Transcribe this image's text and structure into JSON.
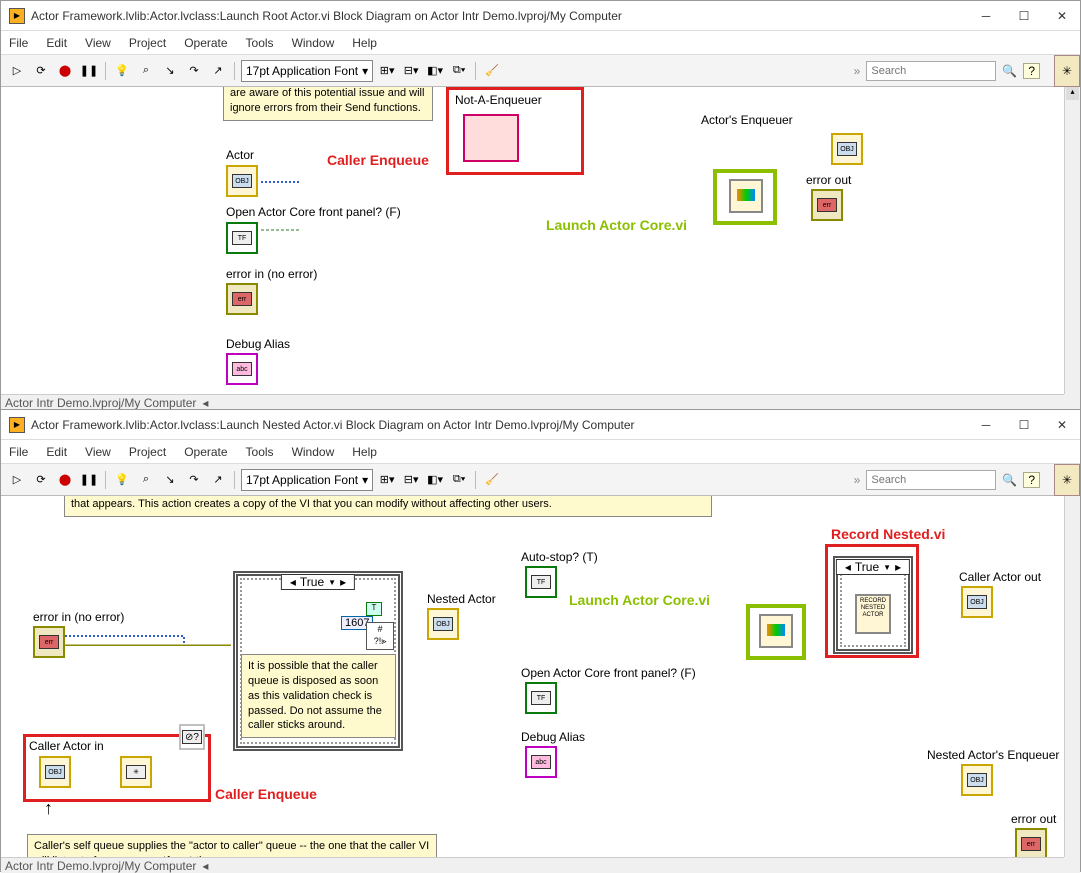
{
  "top": {
    "title": "Actor Framework.lvlib:Actor.lvclass:Launch Root Actor.vi Block Diagram on Actor Intr Demo.lvproj/My Computer",
    "menu": [
      "File",
      "Edit",
      "View",
      "Project",
      "Operate",
      "Tools",
      "Window",
      "Help"
    ],
    "font": "17pt Application Font",
    "search_placeholder": "Search",
    "path": "Actor Intr Demo.lvproj/My Computer",
    "tip": "are aware of this potential issue and will ignore errors from their Send functions.",
    "labels": {
      "actor": "Actor",
      "open_fp": "Open Actor Core front panel? (F)",
      "errin": "error in (no error)",
      "debug": "Debug Alias",
      "nae": "Not-A-Enqueuer",
      "actorenq": "Actor's Enqueuer",
      "errout": "error out"
    },
    "ann": {
      "caller_enq": "Caller Enqueue",
      "launch": "Launch Actor Core.vi"
    }
  },
  "bot": {
    "title": "Actor Framework.lvlib:Actor.lvclass:Launch Nested Actor.vi Block Diagram on Actor Intr Demo.lvproj/My Computer",
    "menu": [
      "File",
      "Edit",
      "View",
      "Project",
      "Operate",
      "Tools",
      "Window",
      "Help"
    ],
    "font": "17pt Application Font",
    "search_placeholder": "Search",
    "path": "Actor Intr Demo.lvproj/My Computer",
    "tip_top": "that appears. This action creates a copy of the VI that you can modify without affecting other users.",
    "tip_case": "It is possible that the caller queue is disposed as soon as this validation check is passed. Do not assume the caller sticks around.",
    "tip_bottom": "Caller's self queue  supplies the \"actor to caller\" queue -- the one that the caller VI will listen to for messages *from* the",
    "case": "True",
    "record_case": "True",
    "const": "1607",
    "record_inner": "RECORD NESTED ACTOR",
    "labels": {
      "errin": "error in (no error)",
      "caller_in": "Caller Actor in",
      "autostop": "Auto-stop? (T)",
      "nested": "Nested Actor",
      "open_fp": "Open Actor Core front panel? (F)",
      "debug": "Debug Alias",
      "caller_out": "Caller Actor out",
      "nested_enq": "Nested Actor's Enqueuer",
      "errout": "error out"
    },
    "ann": {
      "caller_enq": "Caller Enqueue",
      "launch": "Launch Actor Core.vi",
      "record": "Record Nested.vi"
    }
  }
}
